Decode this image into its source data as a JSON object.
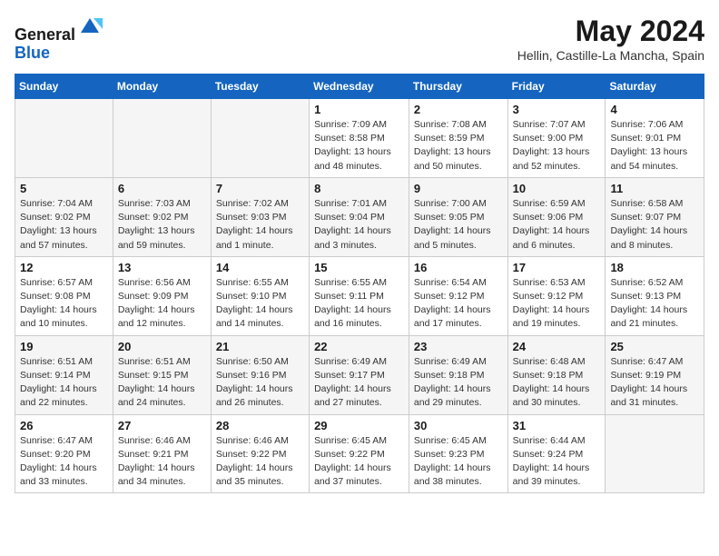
{
  "header": {
    "logo_line1": "General",
    "logo_line2": "Blue",
    "month": "May 2024",
    "location": "Hellin, Castille-La Mancha, Spain"
  },
  "weekdays": [
    "Sunday",
    "Monday",
    "Tuesday",
    "Wednesday",
    "Thursday",
    "Friday",
    "Saturday"
  ],
  "weeks": [
    [
      {
        "day": "",
        "info": ""
      },
      {
        "day": "",
        "info": ""
      },
      {
        "day": "",
        "info": ""
      },
      {
        "day": "1",
        "info": "Sunrise: 7:09 AM\nSunset: 8:58 PM\nDaylight: 13 hours\nand 48 minutes."
      },
      {
        "day": "2",
        "info": "Sunrise: 7:08 AM\nSunset: 8:59 PM\nDaylight: 13 hours\nand 50 minutes."
      },
      {
        "day": "3",
        "info": "Sunrise: 7:07 AM\nSunset: 9:00 PM\nDaylight: 13 hours\nand 52 minutes."
      },
      {
        "day": "4",
        "info": "Sunrise: 7:06 AM\nSunset: 9:01 PM\nDaylight: 13 hours\nand 54 minutes."
      }
    ],
    [
      {
        "day": "5",
        "info": "Sunrise: 7:04 AM\nSunset: 9:02 PM\nDaylight: 13 hours\nand 57 minutes."
      },
      {
        "day": "6",
        "info": "Sunrise: 7:03 AM\nSunset: 9:02 PM\nDaylight: 13 hours\nand 59 minutes."
      },
      {
        "day": "7",
        "info": "Sunrise: 7:02 AM\nSunset: 9:03 PM\nDaylight: 14 hours\nand 1 minute."
      },
      {
        "day": "8",
        "info": "Sunrise: 7:01 AM\nSunset: 9:04 PM\nDaylight: 14 hours\nand 3 minutes."
      },
      {
        "day": "9",
        "info": "Sunrise: 7:00 AM\nSunset: 9:05 PM\nDaylight: 14 hours\nand 5 minutes."
      },
      {
        "day": "10",
        "info": "Sunrise: 6:59 AM\nSunset: 9:06 PM\nDaylight: 14 hours\nand 6 minutes."
      },
      {
        "day": "11",
        "info": "Sunrise: 6:58 AM\nSunset: 9:07 PM\nDaylight: 14 hours\nand 8 minutes."
      }
    ],
    [
      {
        "day": "12",
        "info": "Sunrise: 6:57 AM\nSunset: 9:08 PM\nDaylight: 14 hours\nand 10 minutes."
      },
      {
        "day": "13",
        "info": "Sunrise: 6:56 AM\nSunset: 9:09 PM\nDaylight: 14 hours\nand 12 minutes."
      },
      {
        "day": "14",
        "info": "Sunrise: 6:55 AM\nSunset: 9:10 PM\nDaylight: 14 hours\nand 14 minutes."
      },
      {
        "day": "15",
        "info": "Sunrise: 6:55 AM\nSunset: 9:11 PM\nDaylight: 14 hours\nand 16 minutes."
      },
      {
        "day": "16",
        "info": "Sunrise: 6:54 AM\nSunset: 9:12 PM\nDaylight: 14 hours\nand 17 minutes."
      },
      {
        "day": "17",
        "info": "Sunrise: 6:53 AM\nSunset: 9:12 PM\nDaylight: 14 hours\nand 19 minutes."
      },
      {
        "day": "18",
        "info": "Sunrise: 6:52 AM\nSunset: 9:13 PM\nDaylight: 14 hours\nand 21 minutes."
      }
    ],
    [
      {
        "day": "19",
        "info": "Sunrise: 6:51 AM\nSunset: 9:14 PM\nDaylight: 14 hours\nand 22 minutes."
      },
      {
        "day": "20",
        "info": "Sunrise: 6:51 AM\nSunset: 9:15 PM\nDaylight: 14 hours\nand 24 minutes."
      },
      {
        "day": "21",
        "info": "Sunrise: 6:50 AM\nSunset: 9:16 PM\nDaylight: 14 hours\nand 26 minutes."
      },
      {
        "day": "22",
        "info": "Sunrise: 6:49 AM\nSunset: 9:17 PM\nDaylight: 14 hours\nand 27 minutes."
      },
      {
        "day": "23",
        "info": "Sunrise: 6:49 AM\nSunset: 9:18 PM\nDaylight: 14 hours\nand 29 minutes."
      },
      {
        "day": "24",
        "info": "Sunrise: 6:48 AM\nSunset: 9:18 PM\nDaylight: 14 hours\nand 30 minutes."
      },
      {
        "day": "25",
        "info": "Sunrise: 6:47 AM\nSunset: 9:19 PM\nDaylight: 14 hours\nand 31 minutes."
      }
    ],
    [
      {
        "day": "26",
        "info": "Sunrise: 6:47 AM\nSunset: 9:20 PM\nDaylight: 14 hours\nand 33 minutes."
      },
      {
        "day": "27",
        "info": "Sunrise: 6:46 AM\nSunset: 9:21 PM\nDaylight: 14 hours\nand 34 minutes."
      },
      {
        "day": "28",
        "info": "Sunrise: 6:46 AM\nSunset: 9:22 PM\nDaylight: 14 hours\nand 35 minutes."
      },
      {
        "day": "29",
        "info": "Sunrise: 6:45 AM\nSunset: 9:22 PM\nDaylight: 14 hours\nand 37 minutes."
      },
      {
        "day": "30",
        "info": "Sunrise: 6:45 AM\nSunset: 9:23 PM\nDaylight: 14 hours\nand 38 minutes."
      },
      {
        "day": "31",
        "info": "Sunrise: 6:44 AM\nSunset: 9:24 PM\nDaylight: 14 hours\nand 39 minutes."
      },
      {
        "day": "",
        "info": ""
      }
    ]
  ]
}
